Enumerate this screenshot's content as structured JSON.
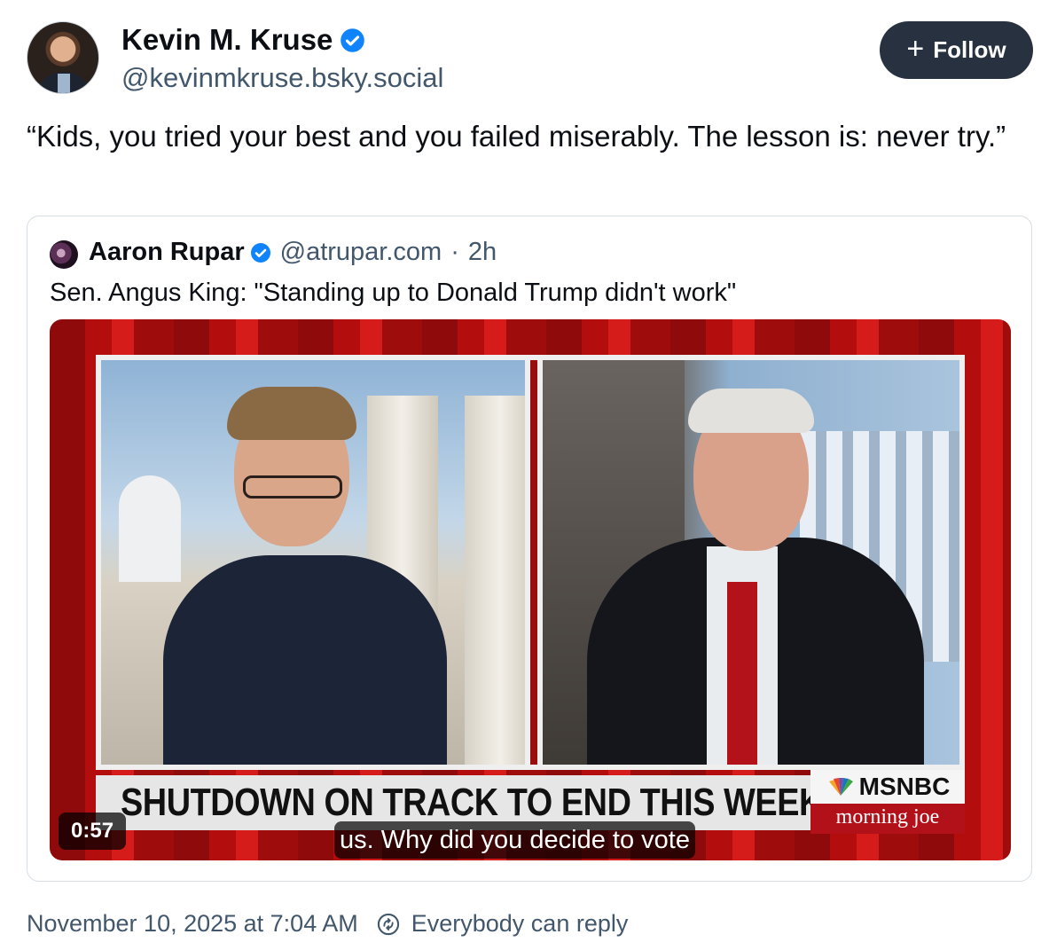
{
  "author": {
    "name": "Kevin M. Kruse",
    "handle": "@kevinmkruse.bsky.social",
    "verified": true
  },
  "follow_button": {
    "label": "Follow",
    "icon": "plus-icon"
  },
  "post": {
    "text": "“Kids, you tried your best and you failed miserably. The lesson is: never try.”"
  },
  "quote": {
    "author_name": "Aaron Rupar",
    "author_handle": "@atrupar.com",
    "separator": "·",
    "time": "2h",
    "text": "Sen. Angus King: \"Standing up to Donald Trump didn't work\"",
    "video": {
      "headline": "SHUTDOWN ON TRACK TO END THIS WEEK",
      "brand": "MSNBC",
      "show": "morning joe",
      "duration": "0:57",
      "caption": "us. Why did you decide to vote"
    }
  },
  "footer": {
    "timestamp": "November 10, 2025 at 7:04 AM",
    "reply_setting": "Everybody can reply",
    "reply_icon": "reply-restriction-icon"
  },
  "colors": {
    "accent_blue": "#1083fe",
    "follow_bg": "#27313f",
    "muted_text": "#42576c",
    "border": "#d6dde4"
  }
}
